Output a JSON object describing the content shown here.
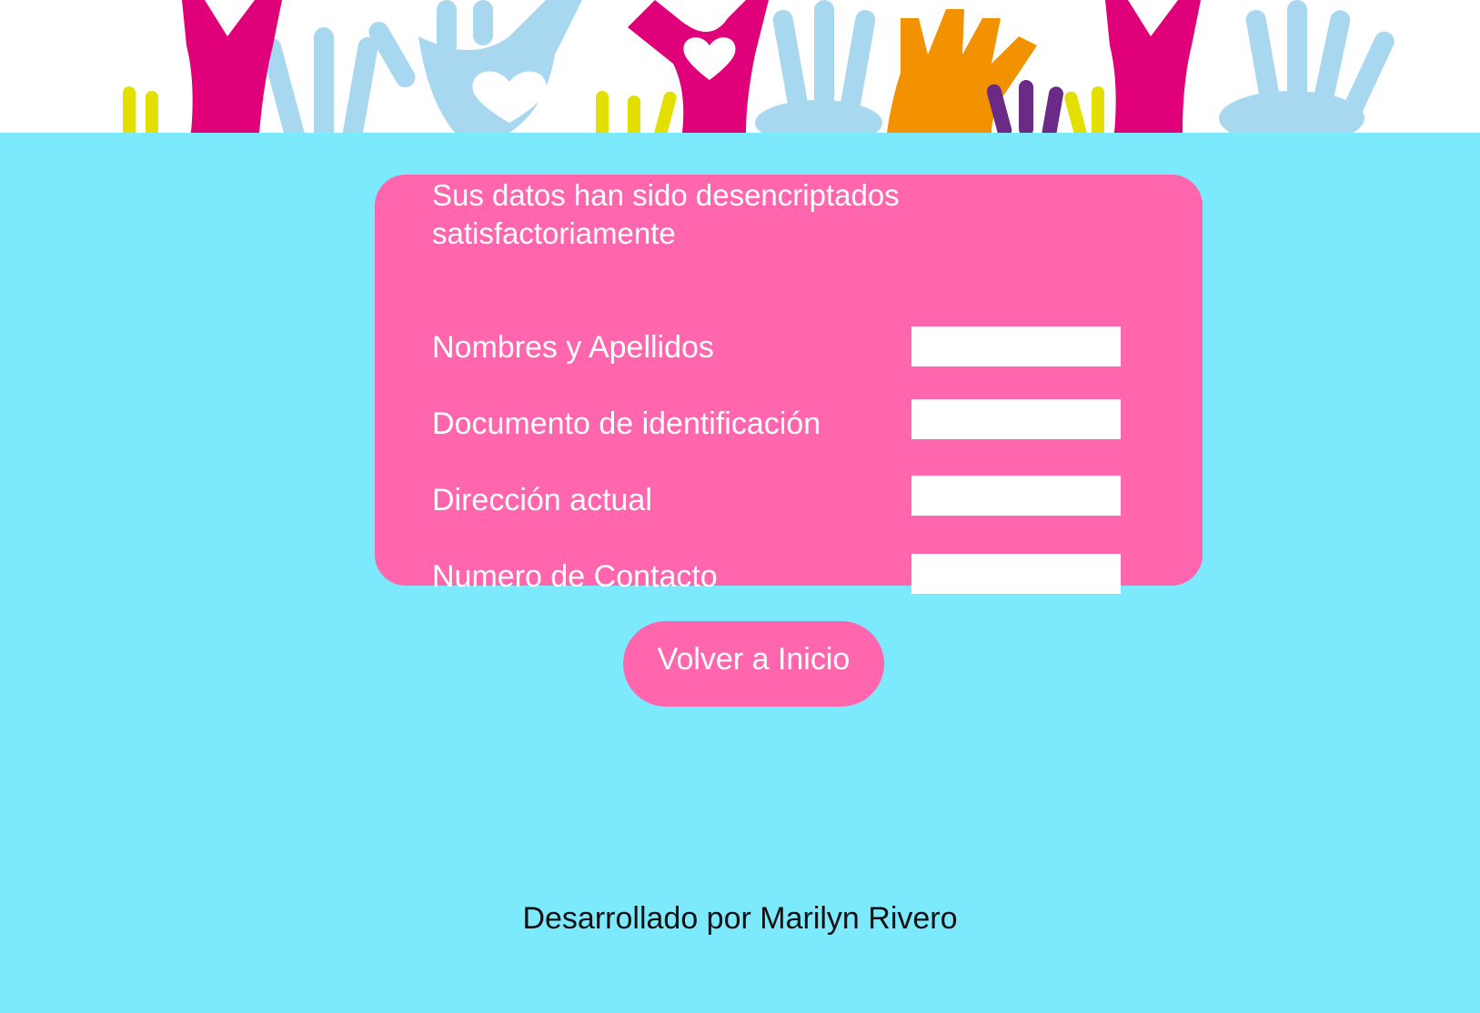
{
  "colors": {
    "background": "#7de9fc",
    "card": "#ff66ad",
    "field": "#ffffff",
    "banner_pink": "#e0007a",
    "banner_lightblue": "#a8d8f0",
    "banner_orange": "#f39200",
    "banner_yellow": "#e3e000",
    "banner_purple": "#6b2a86"
  },
  "banner": {
    "image": "raised-hands-with-hearts-illustration"
  },
  "card": {
    "title": "Sus datos han sido desencriptados satisfactoriamente",
    "rows": [
      {
        "label": "Nombres y Apellidos",
        "value": ""
      },
      {
        "label": "Documento de identificación",
        "value": ""
      },
      {
        "label": "Dirección actual",
        "value": ""
      },
      {
        "label": "Numero de Contacto",
        "value": ""
      }
    ]
  },
  "actions": {
    "home_label": "Volver a Inicio"
  },
  "footer": {
    "credit": "Desarrollado por Marilyn Rivero"
  }
}
